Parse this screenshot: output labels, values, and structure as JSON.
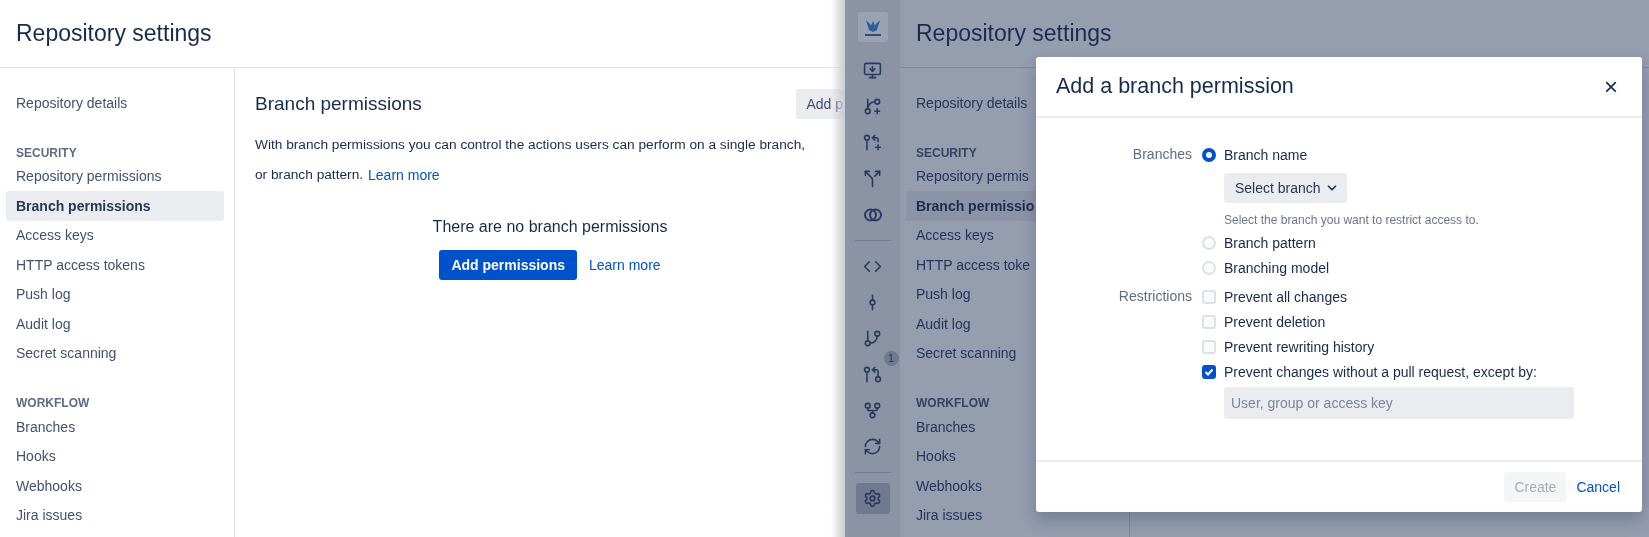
{
  "left": {
    "title": "Repository settings",
    "sidebar": [
      {
        "items": [
          {
            "label": "Repository details",
            "selected": false
          }
        ]
      },
      {
        "heading": "SECURITY",
        "items": [
          {
            "label": "Repository permissions",
            "selected": false
          },
          {
            "label": "Branch permissions",
            "selected": true
          },
          {
            "label": "Access keys",
            "selected": false
          },
          {
            "label": "HTTP access tokens",
            "selected": false
          },
          {
            "label": "Push log",
            "selected": false
          },
          {
            "label": "Audit log",
            "selected": false
          },
          {
            "label": "Secret scanning",
            "selected": false
          }
        ]
      },
      {
        "heading": "WORKFLOW",
        "items": [
          {
            "label": "Branches",
            "selected": false
          },
          {
            "label": "Hooks",
            "selected": false
          },
          {
            "label": "Webhooks",
            "selected": false
          },
          {
            "label": "Jira issues",
            "selected": false
          }
        ]
      }
    ],
    "content": {
      "heading": "Branch permissions",
      "header_button": "Add p",
      "description_line_1": "With branch permissions you can control the actions users can perform on a single branch,",
      "description_line_2": "or branch pattern.",
      "description_link": "Learn more",
      "empty_title": "There are no branch permissions",
      "primary_button": "Add permissions",
      "empty_link": "Learn more"
    }
  },
  "right": {
    "nav_groups": [
      [
        {
          "kind": "logo"
        },
        {
          "kind": "clone",
          "selected": false
        },
        {
          "kind": "branch-add",
          "selected": false
        },
        {
          "kind": "pr-add",
          "selected": false
        },
        {
          "kind": "fork-add",
          "selected": false
        },
        {
          "kind": "compare",
          "selected": false
        }
      ],
      [
        {
          "kind": "code",
          "selected": false
        },
        {
          "kind": "commit",
          "selected": false
        },
        {
          "kind": "branch",
          "selected": false
        },
        {
          "kind": "pr",
          "selected": false,
          "badge": "1"
        },
        {
          "kind": "fork",
          "selected": false
        },
        {
          "kind": "sync",
          "selected": false
        }
      ],
      [
        {
          "kind": "settings",
          "selected": true
        }
      ]
    ],
    "title": "Repository settings",
    "sidebar": [
      {
        "items": [
          {
            "label": "Repository details",
            "selected": false
          }
        ]
      },
      {
        "heading": "SECURITY",
        "items": [
          {
            "label": "Repository permis",
            "selected": false
          },
          {
            "label": "Branch permissio",
            "selected": true
          },
          {
            "label": "Access keys",
            "selected": false
          },
          {
            "label": "HTTP access toke",
            "selected": false
          },
          {
            "label": "Push log",
            "selected": false
          },
          {
            "label": "Audit log",
            "selected": false
          },
          {
            "label": "Secret scanning",
            "selected": false
          }
        ]
      },
      {
        "heading": "WORKFLOW",
        "items": [
          {
            "label": "Branches",
            "selected": false
          },
          {
            "label": "Hooks",
            "selected": false
          },
          {
            "label": "Webhooks",
            "selected": false
          },
          {
            "label": "Jira issues",
            "selected": false
          }
        ]
      }
    ],
    "modal": {
      "title": "Add a branch permission",
      "close": "×",
      "branches_label": "Branches",
      "branch_options": [
        {
          "label": "Branch name",
          "selected": true,
          "select": "Select branch",
          "hint": "Select the branch you want to restrict access to."
        },
        {
          "label": "Branch pattern",
          "selected": false
        },
        {
          "label": "Branching model",
          "selected": false
        }
      ],
      "restrictions_label": "Restrictions",
      "restrictions": [
        {
          "label": "Prevent all changes",
          "checked": false
        },
        {
          "label": "Prevent deletion",
          "checked": false
        },
        {
          "label": "Prevent rewriting history",
          "checked": false
        },
        {
          "label": "Prevent changes without a pull request, except by:",
          "checked": true,
          "placeholder": "User, group or access key"
        }
      ],
      "create": {
        "label": "Create",
        "disabled": true
      },
      "cancel": "Cancel"
    }
  }
}
